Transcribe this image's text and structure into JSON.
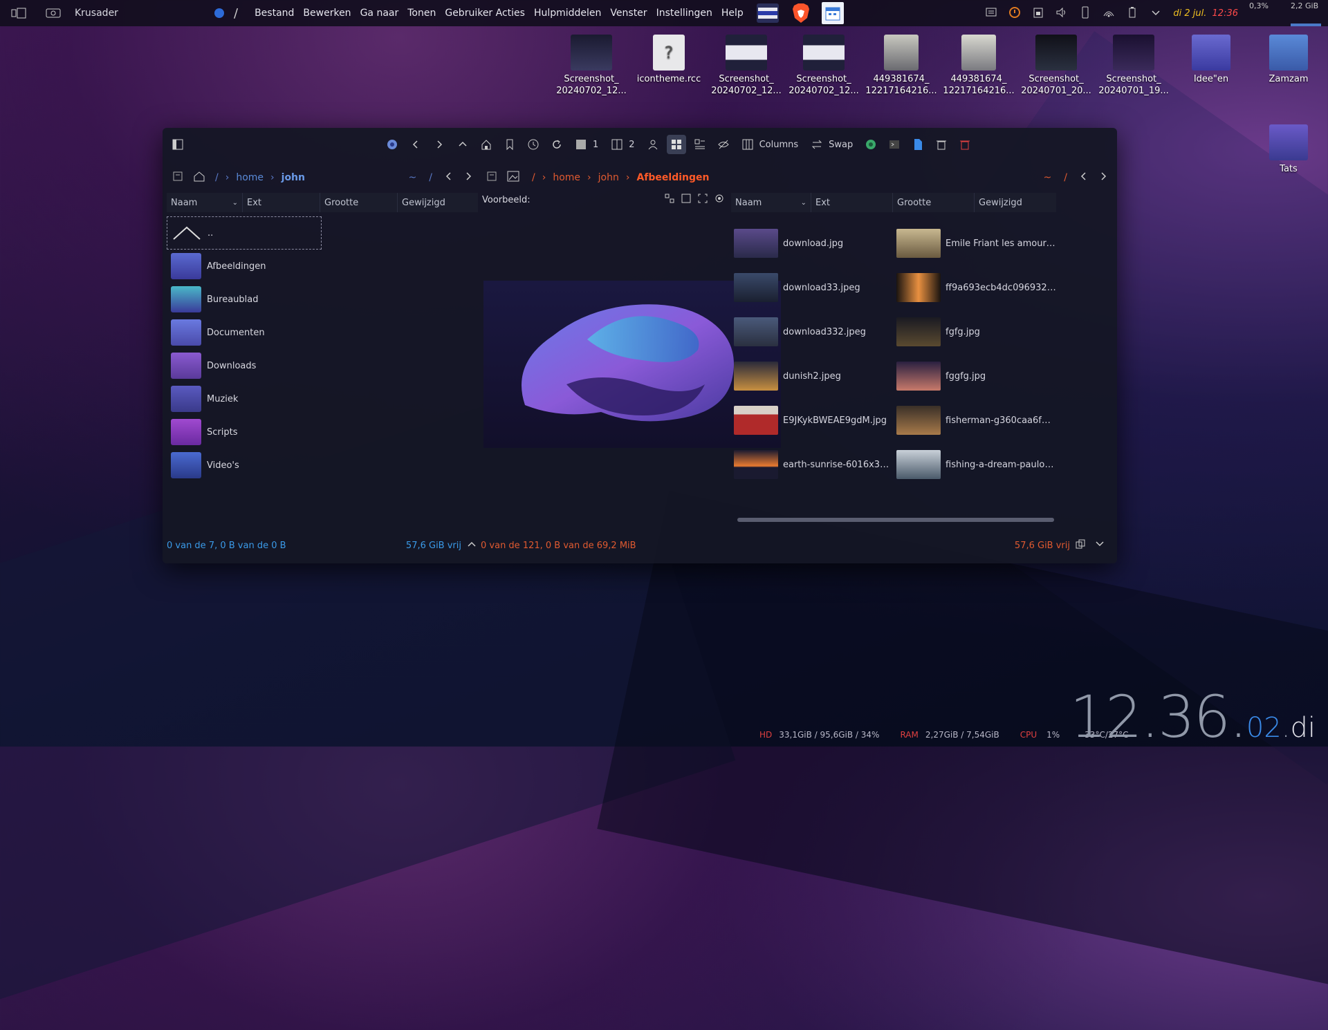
{
  "panel": {
    "app_name": "Krusader",
    "menu": [
      "Bestand",
      "Bewerken",
      "Ga naar",
      "Tonen",
      "Gebruiker Acties",
      "Hulpmiddelen",
      "Venster",
      "Instellingen",
      "Help"
    ],
    "date": "di 2 jul.",
    "time": "12:36",
    "cpu": "0,3%",
    "mem": "2,2 GiB"
  },
  "desktop": [
    {
      "label": "Screenshot_\n20240702_12..."
    },
    {
      "label": "icontheme.rcc"
    },
    {
      "label": "Screenshot_\n20240702_12..."
    },
    {
      "label": "Screenshot_\n20240702_12..."
    },
    {
      "label": "449381674_\n12217164216..."
    },
    {
      "label": "449381674_\n12217164216..."
    },
    {
      "label": "Screenshot_\n20240701_20..."
    },
    {
      "label": "Screenshot_\n20240701_19..."
    },
    {
      "label": "Idee\"en"
    },
    {
      "label": "Zamzam"
    },
    {
      "label": "Tats"
    }
  ],
  "toolbar": {
    "tab1": "1",
    "tab2": "2",
    "columns_label": "Columns",
    "swap_label": "Swap"
  },
  "left_pane": {
    "path": [
      "/",
      "home",
      "john"
    ],
    "root": "~",
    "slash": "/",
    "columns": [
      "Naam",
      "Ext",
      "Grootte",
      "Gewijzigd"
    ],
    "up_label": "..",
    "folders": [
      "Afbeeldingen",
      "Bureaublad",
      "Documenten",
      "Downloads",
      "Muziek",
      "Scripts",
      "Video's"
    ],
    "status": "0 van de 7, 0 B van de 0 B",
    "free": "57,6 GiB vrij"
  },
  "preview": {
    "label": "Voorbeeld:"
  },
  "right_pane": {
    "path": [
      "/",
      "home",
      "john",
      "Afbeeldingen"
    ],
    "root": "~",
    "slash": "/",
    "columns": [
      "Naam",
      "Ext",
      "Grootte",
      "Gewijzigd"
    ],
    "files": [
      "download.jpg",
      "Emile Friant les amoure...",
      "download33.jpeg",
      "ff9a693ecb4dc096932fe...",
      "download332.jpeg",
      "fgfg.jpg",
      "dunish2.jpeg",
      "fggfg.jpg",
      "E9JKykBWEAE9gdM.jpg",
      "fisherman-g360caa6f3_...",
      "earth-sunrise-6016x388...",
      "fishing-a-dream-paulo-d..."
    ],
    "status": "0 van de 121, 0 B van de 69,2 MiB",
    "free": "57,6 GiB vrij"
  },
  "stats": {
    "hd_label": "HD",
    "hd_value": "33,1GiB / 95,6GiB / 34%",
    "ram_label": "RAM",
    "ram_value": "2,27GiB / 7,54GiB",
    "cpu_label": "CPU",
    "cpu_value": "1%",
    "temp": "33°C/27°C"
  },
  "clock": {
    "hm": "12.36.",
    "sec": "02",
    "day": "di"
  }
}
